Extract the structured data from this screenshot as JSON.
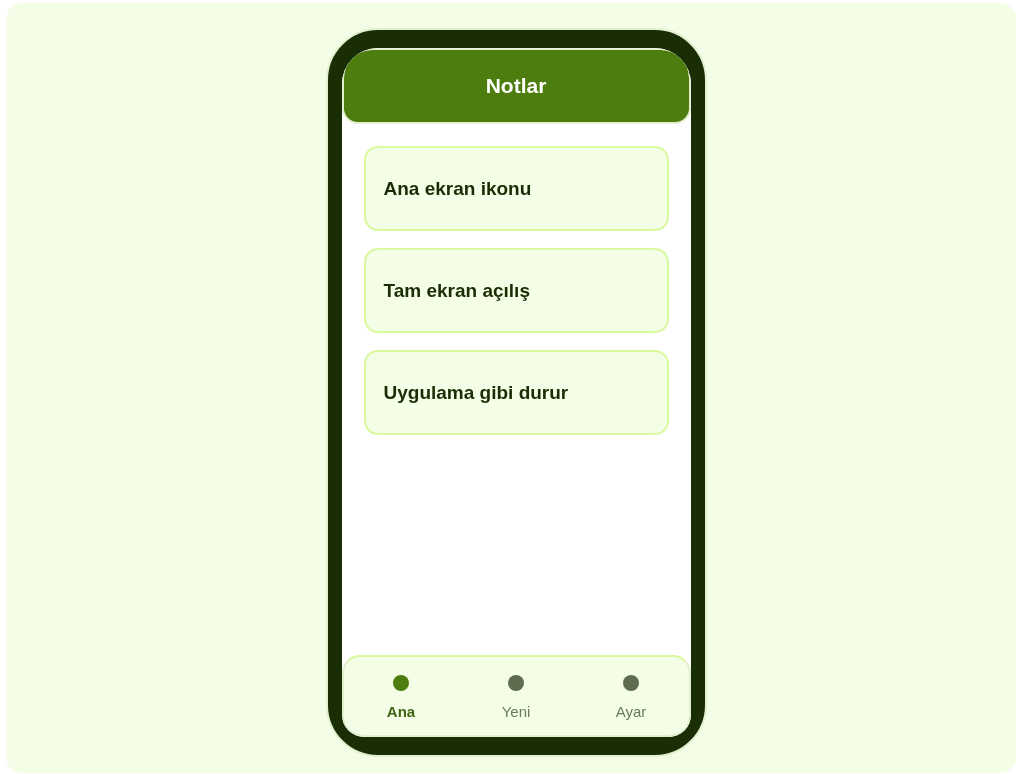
{
  "header": {
    "title": "Notlar"
  },
  "cards": [
    {
      "title": "Ana ekran ikonu"
    },
    {
      "title": "Tam ekran açılış"
    },
    {
      "title": "Uygulama gibi durur"
    }
  ],
  "nav": [
    {
      "label": "Ana",
      "selected": true
    },
    {
      "label": "Yeni",
      "selected": false
    },
    {
      "label": "Ayar",
      "selected": false
    }
  ]
}
